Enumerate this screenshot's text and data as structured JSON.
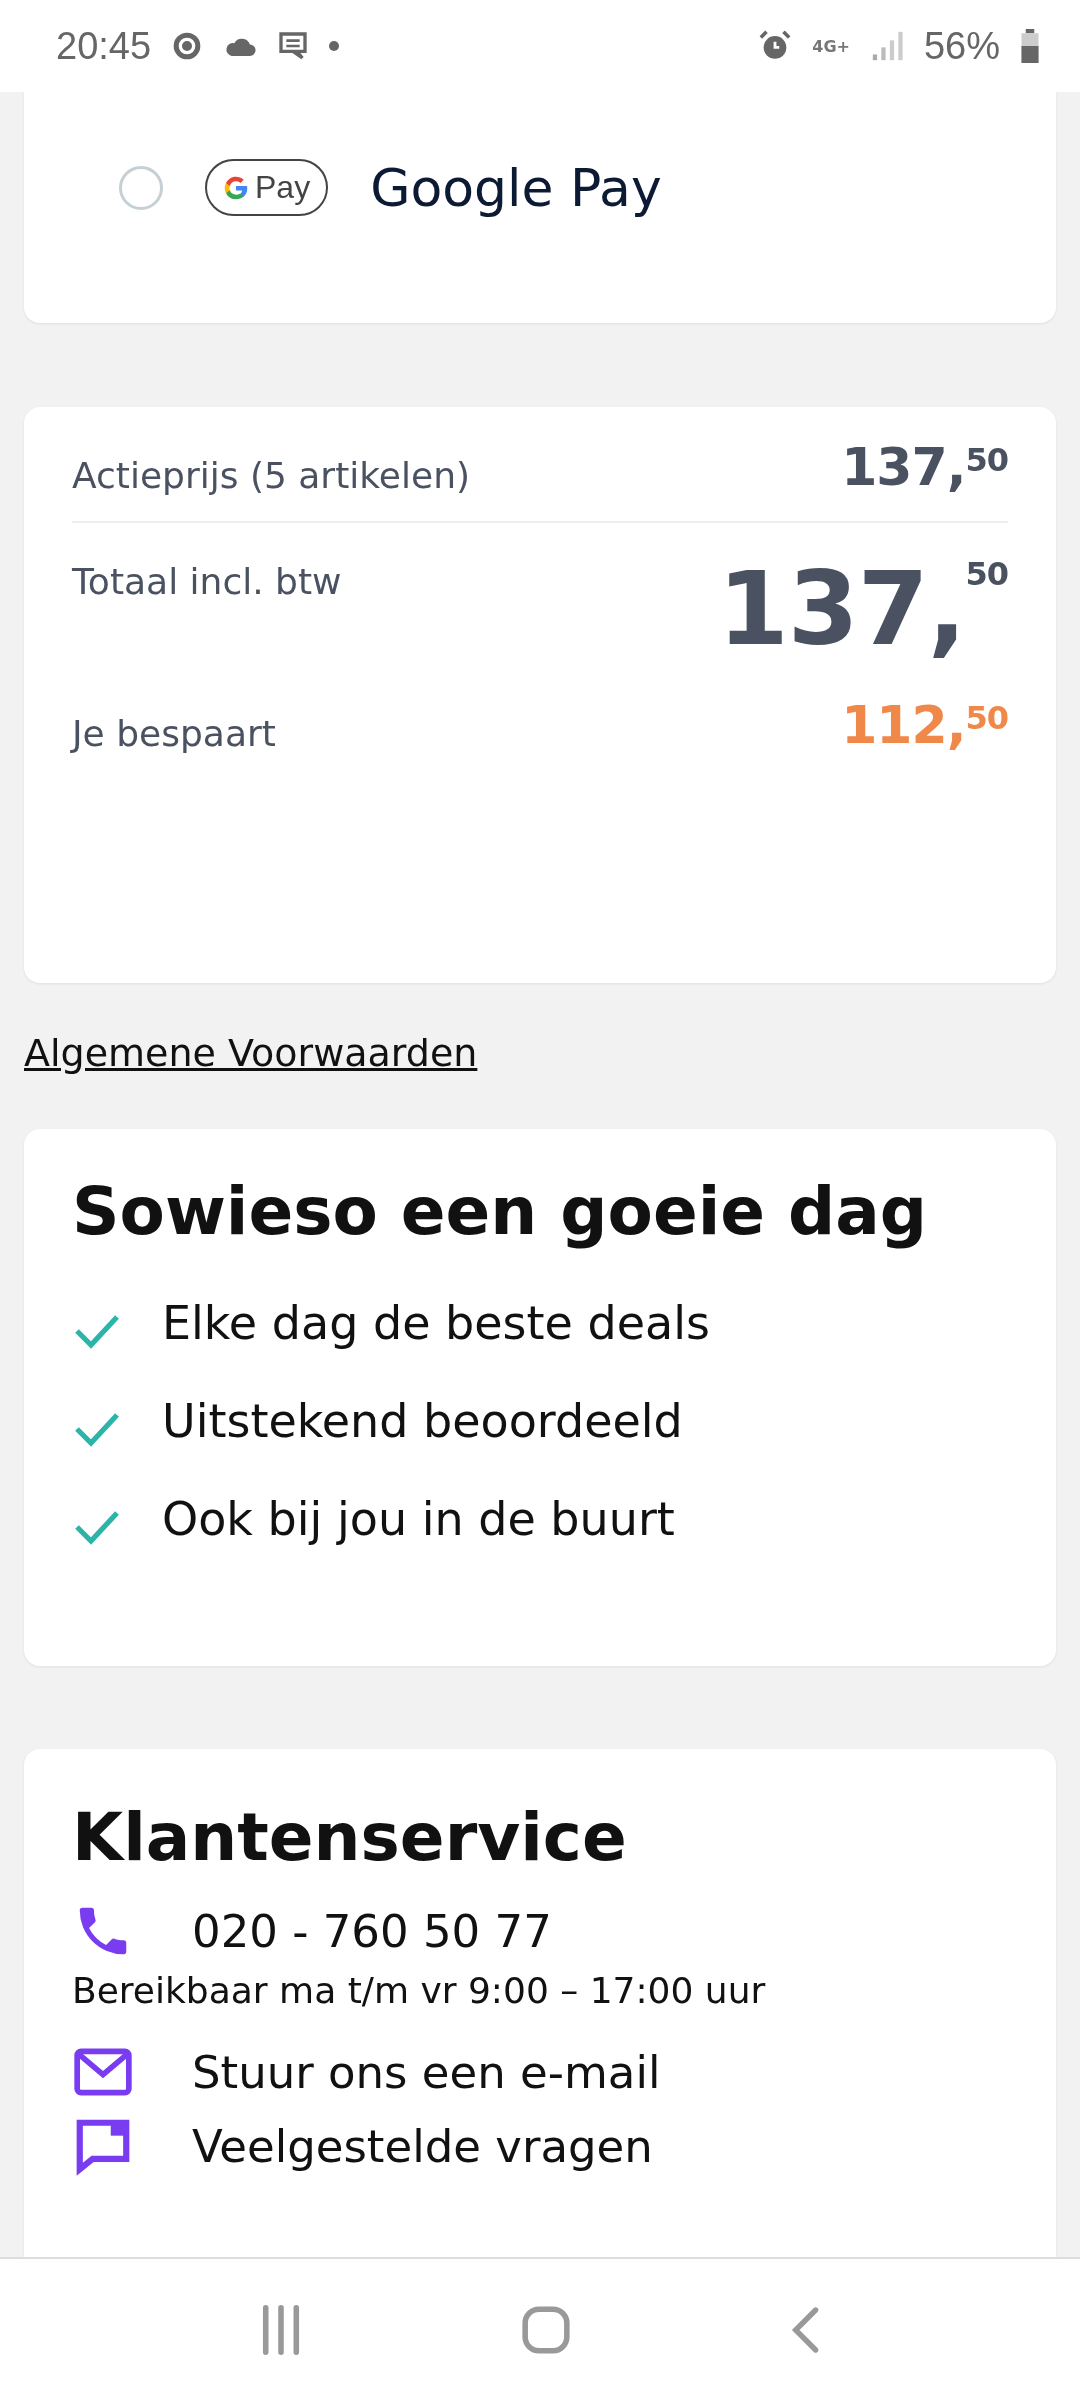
{
  "status_bar": {
    "time": "20:45",
    "battery": "56%",
    "network": "4G+"
  },
  "payment_option": {
    "label": "Google Pay",
    "badge": "Pay",
    "selected": false
  },
  "summary": {
    "rows": [
      {
        "label": "Actieprijs (5 artikelen)",
        "amount": "137,",
        "cents": "50",
        "kind": "normal"
      },
      {
        "label": "Totaal incl. btw",
        "amount": "137,",
        "cents": "50",
        "kind": "total"
      },
      {
        "label": "Je bespaart",
        "amount": "112,",
        "cents": "50",
        "kind": "saving"
      }
    ]
  },
  "terms_link": "Algemene Voorwaarden",
  "usp_card": {
    "title": "Sowieso een goeie dag",
    "items": [
      "Elke dag de beste deals",
      "Uitstekend beoordeeld",
      "Ook bij jou in de buurt"
    ]
  },
  "customer_service": {
    "title": "Klantenservice",
    "items": [
      {
        "kind": "phone",
        "label": "020 - 760 50 77",
        "note": "Bereikbaar ma t/m vr 9:00 – 17:00 uur"
      },
      {
        "kind": "email",
        "label": "Stuur ons een e-mail"
      },
      {
        "kind": "faq",
        "label": "Veelgestelde vragen"
      }
    ]
  }
}
